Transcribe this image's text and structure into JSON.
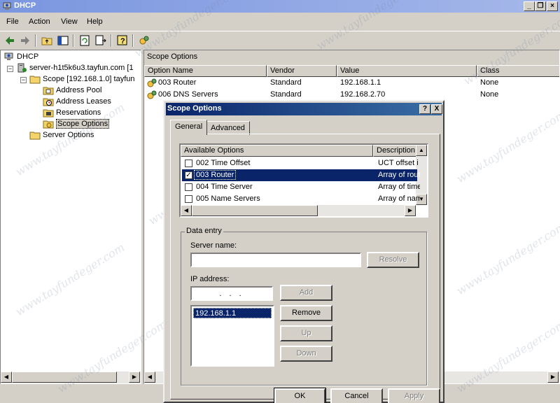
{
  "window": {
    "title": "DHCP"
  },
  "menu": [
    "File",
    "Action",
    "View",
    "Help"
  ],
  "tree": {
    "root": "DHCP",
    "server": "server-h1t5k6u3.tayfun.com [1",
    "scope": "Scope [192.168.1.0] tayfun",
    "scope_children": [
      "Address Pool",
      "Address Leases",
      "Reservations",
      "Scope Options"
    ],
    "server_options": "Server Options"
  },
  "right_pane": {
    "header": "Scope Options",
    "columns": [
      "Option Name",
      "Vendor",
      "Value",
      "Class"
    ],
    "rows": [
      {
        "name": "003 Router",
        "vendor": "Standard",
        "value": "192.168.1.1",
        "class": "None"
      },
      {
        "name": "006 DNS Servers",
        "vendor": "Standard",
        "value": "192.168.2.70",
        "class": "None"
      }
    ]
  },
  "dialog": {
    "title": "Scope Options",
    "help_btn": "?",
    "close_btn": "X",
    "tabs": [
      "General",
      "Advanced"
    ],
    "available_header": "Available Options",
    "description_header": "Description",
    "options": [
      {
        "name": "002 Time Offset",
        "desc": "UCT offset i",
        "checked": false
      },
      {
        "name": "003 Router",
        "desc": "Array of rout",
        "checked": true
      },
      {
        "name": "004 Time Server",
        "desc": "Array of time",
        "checked": false
      },
      {
        "name": "005 Name Servers",
        "desc": "Array of nam",
        "checked": false
      }
    ],
    "data_entry_label": "Data entry",
    "server_name_label": "Server name:",
    "server_name_value": "",
    "resolve_btn": "Resolve",
    "ip_label": "IP address:",
    "ip_value": ".   .   .",
    "add_btn": "Add",
    "remove_btn": "Remove",
    "up_btn": "Up",
    "down_btn": "Down",
    "ip_list": [
      "192.168.1.1"
    ],
    "ok_btn": "OK",
    "cancel_btn": "Cancel",
    "apply_btn": "Apply"
  },
  "watermark": "www.tayfundeger.com",
  "colors": {
    "selection": "#0a246a",
    "window_bg": "#d4d0c8",
    "title_bar": "#7a96df"
  }
}
